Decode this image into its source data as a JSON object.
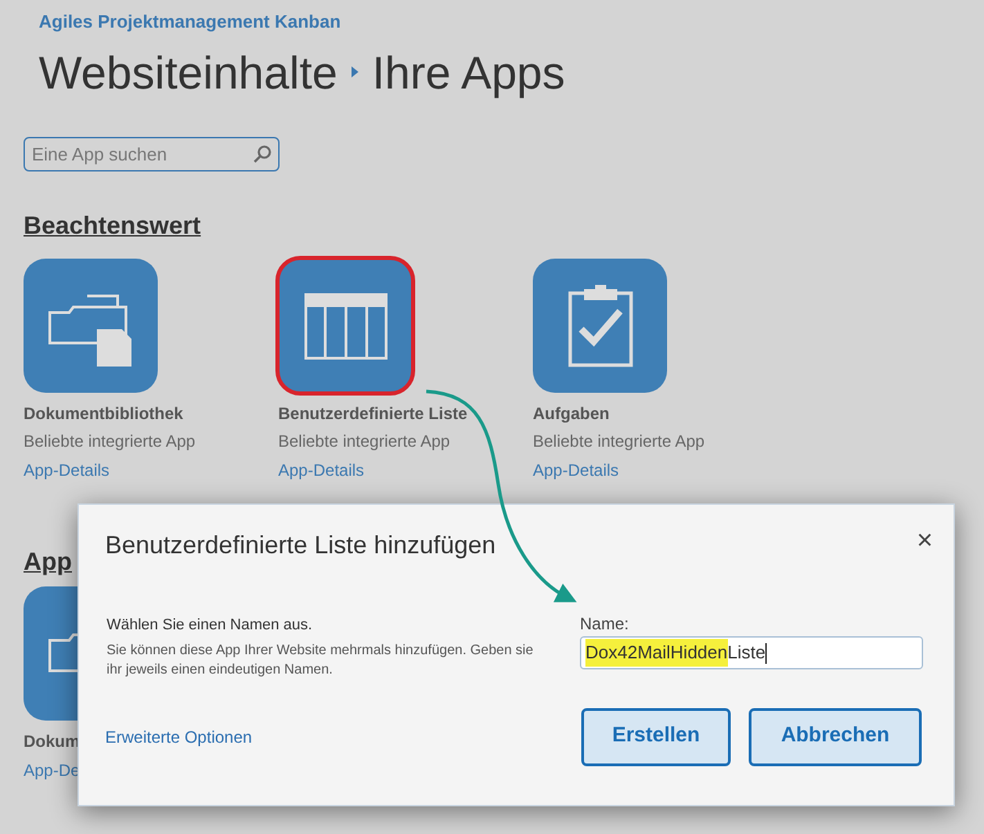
{
  "site_title": "Agiles Projektmanagement Kanban",
  "breadcrumb": [
    "Websiteinhalte",
    "Ihre Apps"
  ],
  "search": {
    "placeholder": "Eine App suchen"
  },
  "featured": {
    "heading": "Beachtenswert",
    "apps": [
      {
        "kind": "folder",
        "name": "Dokumentbibliothek",
        "subtitle": "Beliebte integrierte App",
        "link": "App-Details",
        "selected": false
      },
      {
        "kind": "list",
        "name": "Benutzerdefinierte Liste",
        "subtitle": "Beliebte integrierte App",
        "link": "App-Details",
        "selected": true
      },
      {
        "kind": "tasks",
        "name": "Aufgaben",
        "subtitle": "Beliebte integrierte App",
        "link": "App-Details",
        "selected": false
      }
    ]
  },
  "apps_section": {
    "heading": "App",
    "apps": [
      {
        "kind": "folder",
        "name": "Dokum",
        "link": "App-De"
      }
    ]
  },
  "dialog": {
    "title": "Benutzerdefinierte Liste hinzufügen",
    "close": "×",
    "prompt": "Wählen Sie einen Namen aus.",
    "description": "Sie können diese App Ihrer Website mehrmals hinzufügen. Geben sie ihr jeweils einen eindeutigen Namen.",
    "advanced_link": "Erweiterte Optionen",
    "name_label": "Name:",
    "name_value": [
      {
        "text": "Dox42MailHidden",
        "highlighted": true
      },
      {
        "text": "Liste",
        "highlighted": false
      }
    ],
    "buttons": [
      "Erstellen",
      "Abbrechen"
    ]
  }
}
